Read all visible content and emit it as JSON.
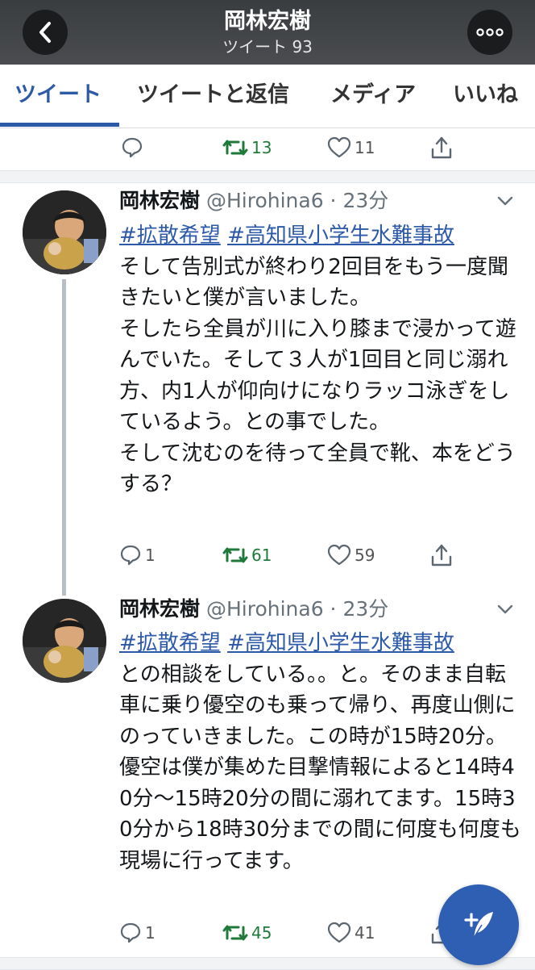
{
  "header": {
    "title": "岡林宏樹",
    "subtitle": "ツイート 93"
  },
  "tabs": [
    {
      "label": "ツイート",
      "active": true
    },
    {
      "label": "ツイートと返信",
      "active": false
    },
    {
      "label": "メディア",
      "active": false
    },
    {
      "label": "いいね",
      "active": false
    }
  ],
  "top_actions": {
    "reply": "",
    "retweet": "13",
    "like": "11"
  },
  "tweets": [
    {
      "name": "岡林宏樹",
      "meta": "@Hirohina6 · 23分",
      "hashtags": [
        "#拡散希望",
        "#高知県小学生水難事故"
      ],
      "text": "そして告別式が終わり2回目をもう一度聞きたいと僕が言いました。\nそしたら全員が川に入り膝まで浸かって遊んでいた。そして３人が1回目と同じ溺れ方、内1人が仰向けになりラッコ泳ぎをしているよう。との事でした。\nそして沈むのを待って全員で靴、本をどうする？",
      "reply": "1",
      "retweet": "61",
      "like": "59"
    },
    {
      "name": "岡林宏樹",
      "meta": "@Hirohina6 · 23分",
      "hashtags": [
        "#拡散希望",
        "#高知県小学生水難事故"
      ],
      "text": "との相談をしている。。と。そのまま自転車に乗り優空のも乗って帰り、再度山側にのっていきました。この時が15時20分。優空は僕が集めた目撃情報によると14時40分〜15時20分の間に溺れてます。15時30分から18時30分までの間に何度も何度も現場に行ってます。",
      "reply": "1",
      "retweet": "45",
      "like": "41"
    }
  ],
  "colors": {
    "accent": "#2c5aa8",
    "retweet": "#1f7a3a",
    "header_bg": "#3a3d40"
  }
}
